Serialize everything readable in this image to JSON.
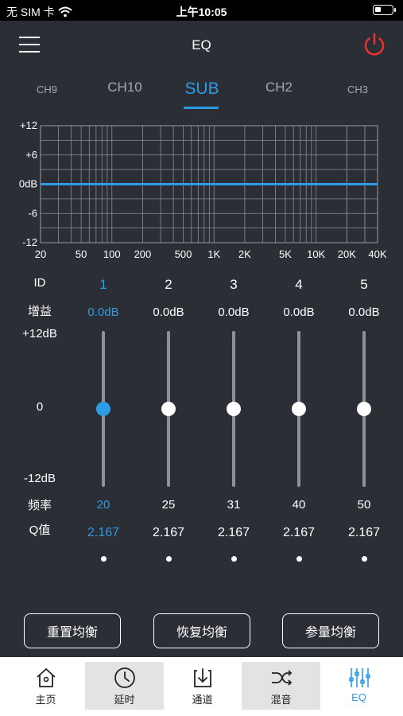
{
  "status": {
    "carrier": "无 SIM 卡",
    "time": "上午10:05",
    "battery_level": 0.35
  },
  "header": {
    "title": "EQ",
    "power_color": "#e5322d",
    "menu_icon": "hamburger-icon",
    "power_icon": "power-icon"
  },
  "channels": {
    "tabs": [
      "CH9",
      "CH10",
      "SUB",
      "CH2",
      "CH3"
    ],
    "active": "SUB"
  },
  "graph": {
    "y_labels": [
      "+12",
      "+6",
      "0dB",
      "-6",
      "-12"
    ],
    "x_labels": [
      "20",
      "50",
      "100",
      "200",
      "500",
      "1K",
      "2K",
      "5K",
      "10K",
      "20K",
      "40K"
    ],
    "curve_db": 0,
    "curve_color": "#2c9ce6"
  },
  "labels": {
    "id": "ID",
    "gain": "增益",
    "max": "+12dB",
    "zero": "0",
    "min": "-12dB",
    "freq": "频率",
    "q": "Q值"
  },
  "bands": [
    {
      "id": "1",
      "gain": "0.0dB",
      "freq": "20",
      "q": "2.167",
      "gain_db": 0,
      "active": true
    },
    {
      "id": "2",
      "gain": "0.0dB",
      "freq": "25",
      "q": "2.167",
      "gain_db": 0,
      "active": false
    },
    {
      "id": "3",
      "gain": "0.0dB",
      "freq": "31",
      "q": "2.167",
      "gain_db": 0,
      "active": false
    },
    {
      "id": "4",
      "gain": "0.0dB",
      "freq": "40",
      "q": "2.167",
      "gain_db": 0,
      "active": false
    },
    {
      "id": "5",
      "gain": "0.0dB",
      "freq": "50",
      "q": "2.167",
      "gain_db": 0,
      "active": false
    }
  ],
  "actions": {
    "reset": "重置均衡",
    "restore": "恢复均衡",
    "param": "参量均衡"
  },
  "tabbar": [
    {
      "label": "主页",
      "icon": "home-icon",
      "active": false
    },
    {
      "label": "延时",
      "icon": "clock-icon",
      "active": false
    },
    {
      "label": "通道",
      "icon": "channel-download-icon",
      "active": false
    },
    {
      "label": "混音",
      "icon": "shuffle-icon",
      "active": false
    },
    {
      "label": "EQ",
      "icon": "eq-sliders-icon",
      "active": true
    }
  ]
}
